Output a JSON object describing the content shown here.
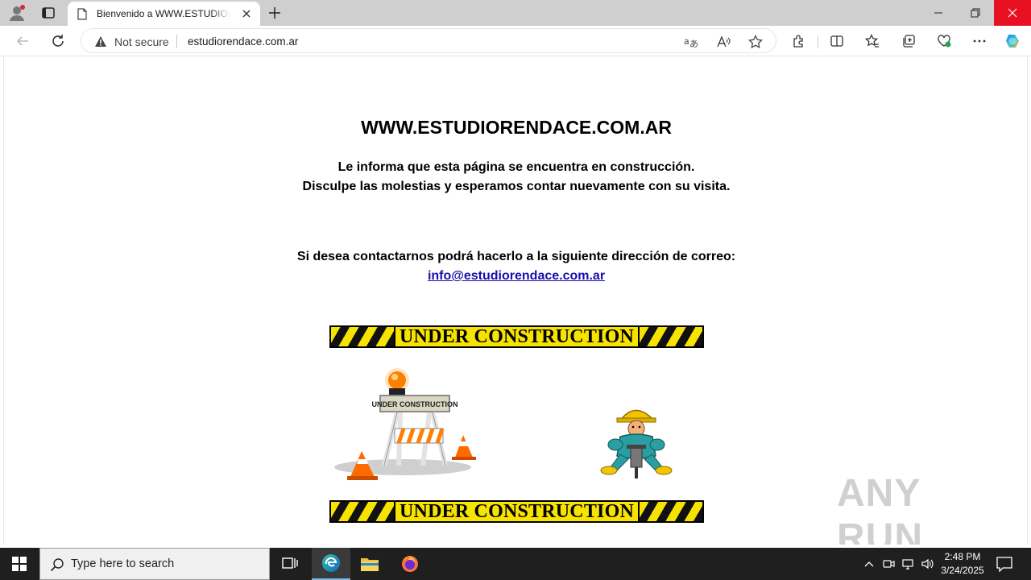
{
  "browser": {
    "tab_title": "Bienvenido a WWW.ESTUDIORENDACE.COM.AR",
    "security_label": "Not secure",
    "url": "estudiorendace.com.ar"
  },
  "page": {
    "title": "WWW.ESTUDIORENDACE.COM.AR",
    "line1": "Le informa que esta página se encuentra en construcción.",
    "line2": "Disculpe las molestias y esperamos contar nuevamente con su visita.",
    "contact_line": "Si desea contactarnos podrá hacerlo a la siguiente dirección de correo:",
    "email": "info@estudiorendace.com.ar",
    "banner_label": "UNDER CONSTRUCTION",
    "barricade_sign": "UNDER CONSTRUCTION"
  },
  "watermark": "ANY RUN",
  "taskbar": {
    "search_placeholder": "Type here to search",
    "time": "2:48 PM",
    "date": "3/24/2025"
  },
  "colors": {
    "hazard_yellow": "#f7e300",
    "link": "#1a0dab",
    "close_red": "#e81123",
    "taskbar": "#1f1f1f"
  }
}
